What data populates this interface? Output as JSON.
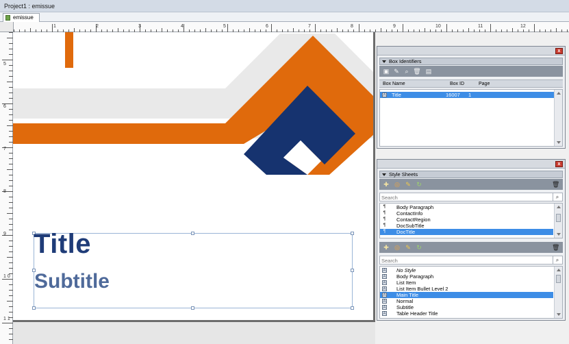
{
  "window": {
    "title": "Project1 : emissue"
  },
  "tabs": [
    {
      "label": "emissue"
    }
  ],
  "ruler": {
    "top_labels": [
      "1",
      "2",
      "3",
      "4",
      "5",
      "6",
      "7",
      "8",
      "9",
      "10",
      "11",
      "12"
    ],
    "left_labels": [
      "5",
      "6",
      "7",
      "8",
      "9",
      "1 0",
      "1 1"
    ]
  },
  "document": {
    "title": "Title",
    "subtitle": "Subtitle"
  },
  "colors": {
    "orange": "#e06a0c",
    "navy": "#16336f",
    "light_gray": "#e9e9e9",
    "title_blue": "#1f3c78",
    "subtitle_blue": "#4f6a9a",
    "selection": "#3d8de6"
  },
  "box_identifiers": {
    "header": "Box Identifiers",
    "close_glyph": "x",
    "tools": [
      "box-icon",
      "edit-icon",
      "find-icon",
      "delete-icon",
      "image-icon"
    ],
    "columns": {
      "name": "Box Name",
      "id": "Box ID",
      "page": "Page"
    },
    "rows": [
      {
        "name": "Title",
        "id": "16007",
        "page": "1",
        "selected": true
      }
    ]
  },
  "style_sheets": {
    "header": "Style Sheets",
    "close_glyph": "x",
    "paragraph": {
      "search_placeholder": "Search",
      "items": [
        {
          "label": "Body Paragraph",
          "marker": "¶"
        },
        {
          "label": "ContactInfo",
          "marker": "¶"
        },
        {
          "label": "ContactRegion",
          "marker": "¶"
        },
        {
          "label": "DocSubTitle",
          "marker": "¶"
        },
        {
          "label": "DocTitle",
          "marker": "¶",
          "selected": true
        }
      ]
    },
    "character": {
      "search_placeholder": "Search",
      "items": [
        {
          "label": "No Style",
          "italic": true
        },
        {
          "label": "Body Paragraph"
        },
        {
          "label": "List Item"
        },
        {
          "label": "List Item Bullet Level 2"
        },
        {
          "label": "Main Title",
          "selected": true
        },
        {
          "label": "Normal"
        },
        {
          "label": "Subtitle"
        },
        {
          "label": "Table Header Title"
        }
      ]
    }
  }
}
